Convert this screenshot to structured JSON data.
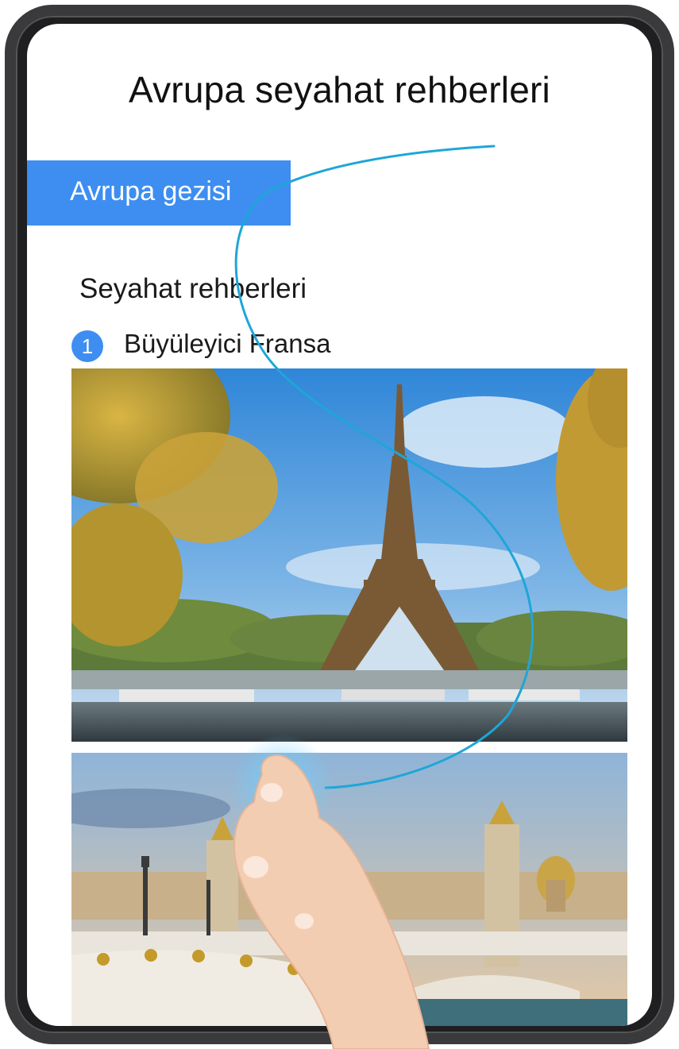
{
  "page": {
    "title": "Avrupa seyahat rehberleri"
  },
  "banner": {
    "label": "Avrupa gezisi"
  },
  "section": {
    "heading": "Seyahat rehberleri"
  },
  "list": [
    {
      "number": "1",
      "label": "Büyüleyici Fransa"
    }
  ],
  "gesture": {
    "icon": "hand-pointer-icon",
    "stroke_color": "#1ea6d8"
  },
  "colors": {
    "accent": "#3d8ef0",
    "bezel": "#3a3a3c"
  }
}
